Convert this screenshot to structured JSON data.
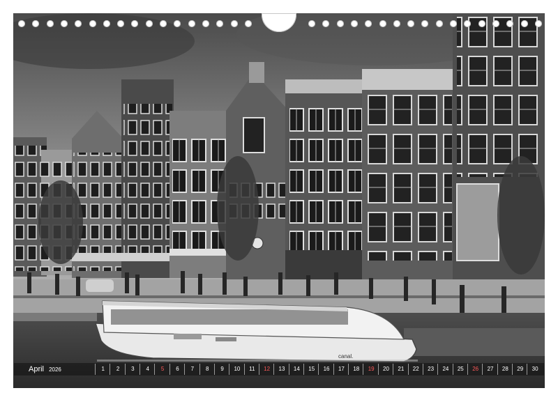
{
  "calendar": {
    "month": "April",
    "year": "2026",
    "days": [
      "1",
      "2",
      "3",
      "4",
      "5",
      "6",
      "7",
      "8",
      "9",
      "10",
      "11",
      "12",
      "13",
      "14",
      "15",
      "16",
      "17",
      "18",
      "19",
      "20",
      "21",
      "22",
      "23",
      "24",
      "25",
      "26",
      "27",
      "28",
      "29",
      "30"
    ],
    "sunday_days": [
      "5",
      "12",
      "19",
      "26"
    ]
  },
  "photo": {
    "boat_sign": "canal."
  },
  "colors": {
    "sunday": "#ff5a5a",
    "strip": "#141414"
  }
}
